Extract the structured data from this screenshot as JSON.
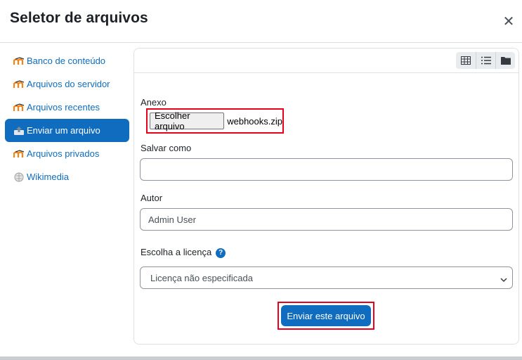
{
  "dialog": {
    "title": "Seletor de arquivos",
    "close_icon": "close-icon"
  },
  "sidebar": {
    "items": [
      {
        "label": "Banco de conteúdo",
        "icon": "moodle-icon",
        "active": false
      },
      {
        "label": "Arquivos do servidor",
        "icon": "moodle-icon",
        "active": false
      },
      {
        "label": "Arquivos recentes",
        "icon": "moodle-icon",
        "active": false
      },
      {
        "label": "Enviar um arquivo",
        "icon": "upload-icon",
        "active": true
      },
      {
        "label": "Arquivos privados",
        "icon": "moodle-icon",
        "active": false
      },
      {
        "label": "Wikimedia",
        "icon": "wikimedia-icon",
        "active": false
      }
    ]
  },
  "toolbar": {
    "views": [
      "grid-view-icon",
      "list-view-icon",
      "folder-view-icon"
    ]
  },
  "form": {
    "attachment_label": "Anexo",
    "choose_file_label": "Escolher arquivo",
    "file_name": "webhooks.zip",
    "save_as_label": "Salvar como",
    "save_as_value": "",
    "author_label": "Autor",
    "author_value": "Admin User",
    "license_label": "Escolha a licença",
    "help_icon": "?",
    "license_value": "Licença não especificada",
    "submit_label": "Enviar este arquivo"
  },
  "colors": {
    "accent": "#0f6cbf",
    "highlight": "#e8001c"
  }
}
